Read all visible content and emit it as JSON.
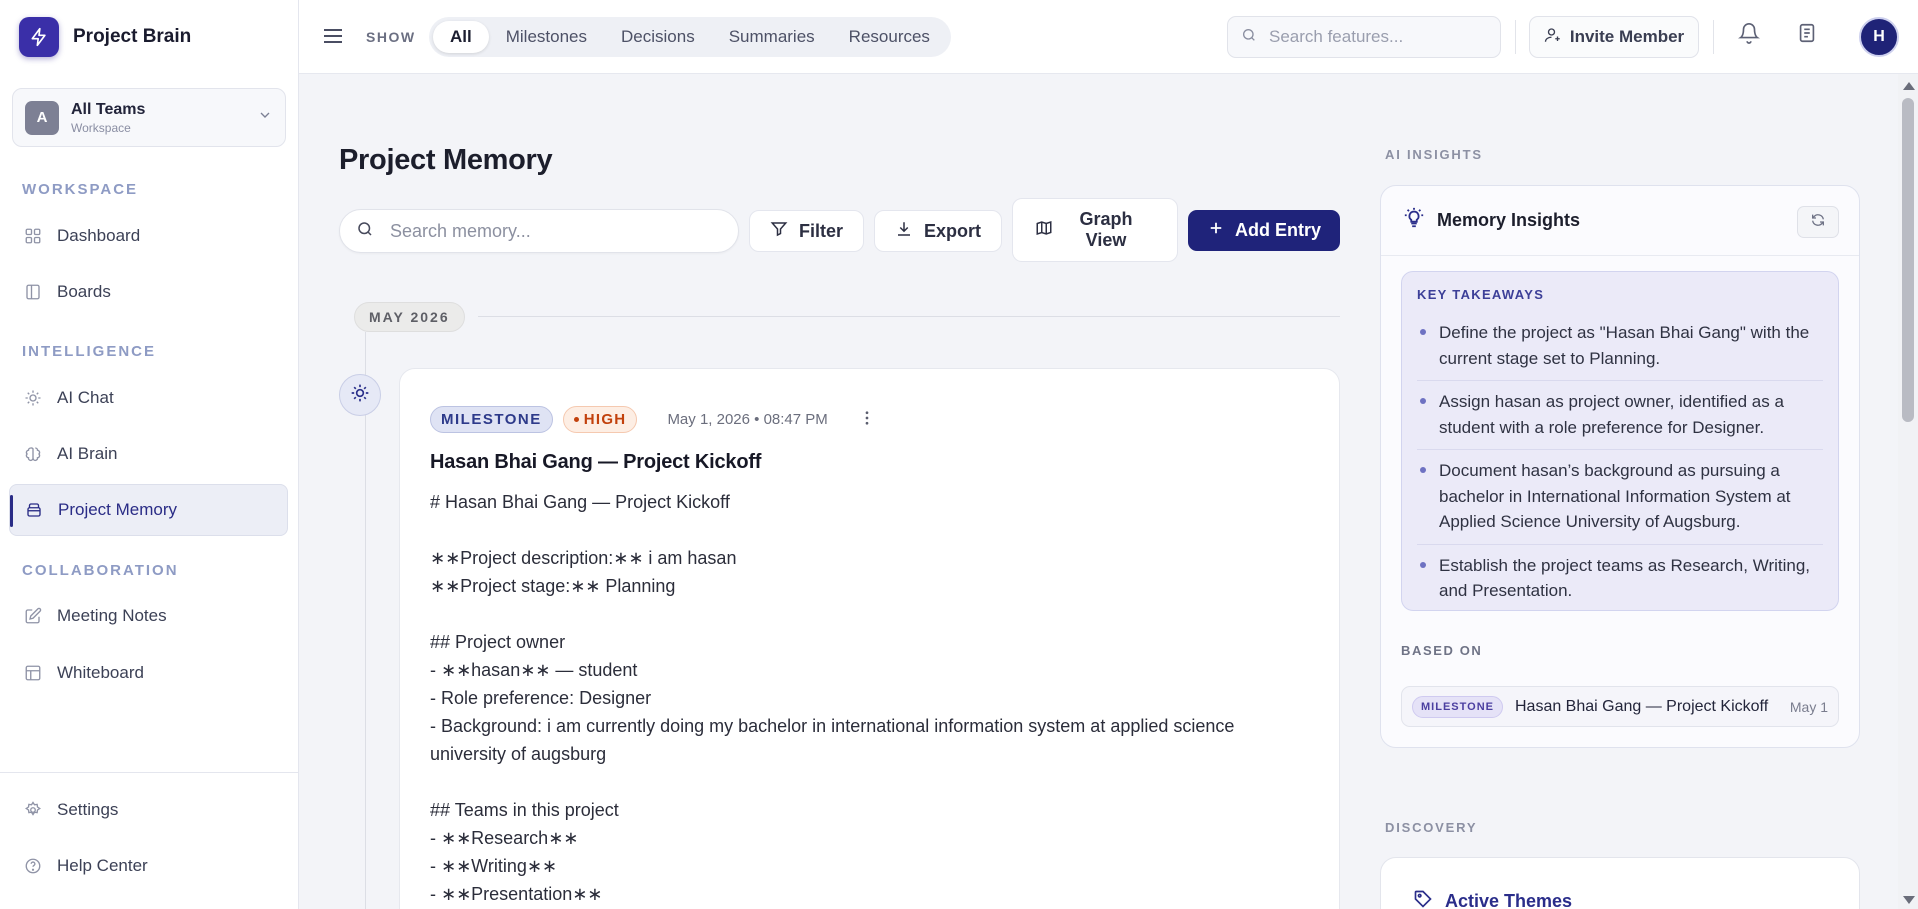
{
  "app": {
    "name": "Project Brain"
  },
  "team": {
    "avatar_letter": "A",
    "name": "All Teams",
    "sub": "Workspace"
  },
  "sidebar": {
    "sections": {
      "workspace": "WORKSPACE",
      "intelligence": "INTELLIGENCE",
      "collaboration": "COLLABORATION"
    },
    "items": {
      "dashboard": "Dashboard",
      "boards": "Boards",
      "ai_chat": "AI Chat",
      "ai_brain": "AI Brain",
      "project_memory": "Project Memory",
      "meeting_notes": "Meeting Notes",
      "whiteboard": "Whiteboard",
      "settings": "Settings",
      "help_center": "Help Center"
    },
    "active_item": "Project Memory"
  },
  "topbar": {
    "show_label": "SHOW",
    "filters": [
      "All",
      "Milestones",
      "Decisions",
      "Summaries",
      "Resources"
    ],
    "active_filter": "All",
    "search_placeholder": "Search features...",
    "invite_label": "Invite Member",
    "user_initial": "H"
  },
  "main": {
    "title": "Project Memory",
    "search_placeholder": "Search memory...",
    "filter_label": "Filter",
    "export_label": "Export",
    "graph_label": "Graph View",
    "add_label": "Add Entry",
    "month_label": "MAY 2026"
  },
  "entry": {
    "type_badge": "MILESTONE",
    "priority_badge": "HIGH",
    "datetime": "May 1, 2026 • 08:47 PM",
    "title": "Hasan Bhai Gang — Project Kickoff",
    "body": "# Hasan Bhai Gang — Project Kickoff\n\n∗∗Project description:∗∗ i am hasan\n∗∗Project stage:∗∗ Planning\n\n## Project owner\n- ∗∗hasan∗∗ — student\n- Role preference: Designer\n- Background: i am currently doing my bachelor in international information system at applied science university of augsburg\n\n## Teams in this project\n- ∗∗Research∗∗\n- ∗∗Writing∗∗\n- ∗∗Presentation∗∗"
  },
  "insights": {
    "section_label": "AI INSIGHTS",
    "title": "Memory Insights",
    "takeaways_label": "KEY TAKEAWAYS",
    "takeaways": [
      "Define the project as \"Hasan Bhai Gang\" with the current stage set to Planning.",
      "Assign hasan as project owner, identified as a student with a role preference for Designer.",
      "Document hasan’s background as pursuing a bachelor in International Information System at Applied Science University of Augsburg.",
      "Establish the project teams as Research, Writing, and Presentation."
    ],
    "based_on_label": "BASED ON",
    "based_on": {
      "badge": "MILESTONE",
      "title": "Hasan Bhai Gang — Project Kickoff",
      "date": "May 1"
    }
  },
  "discovery": {
    "section_label": "DISCOVERY",
    "title": "Active Themes"
  },
  "colors": {
    "brand": "#3a2fa8",
    "primary_button": "#1f237a",
    "active_nav": "#2a2c86",
    "high_priority": "#c2410c"
  }
}
